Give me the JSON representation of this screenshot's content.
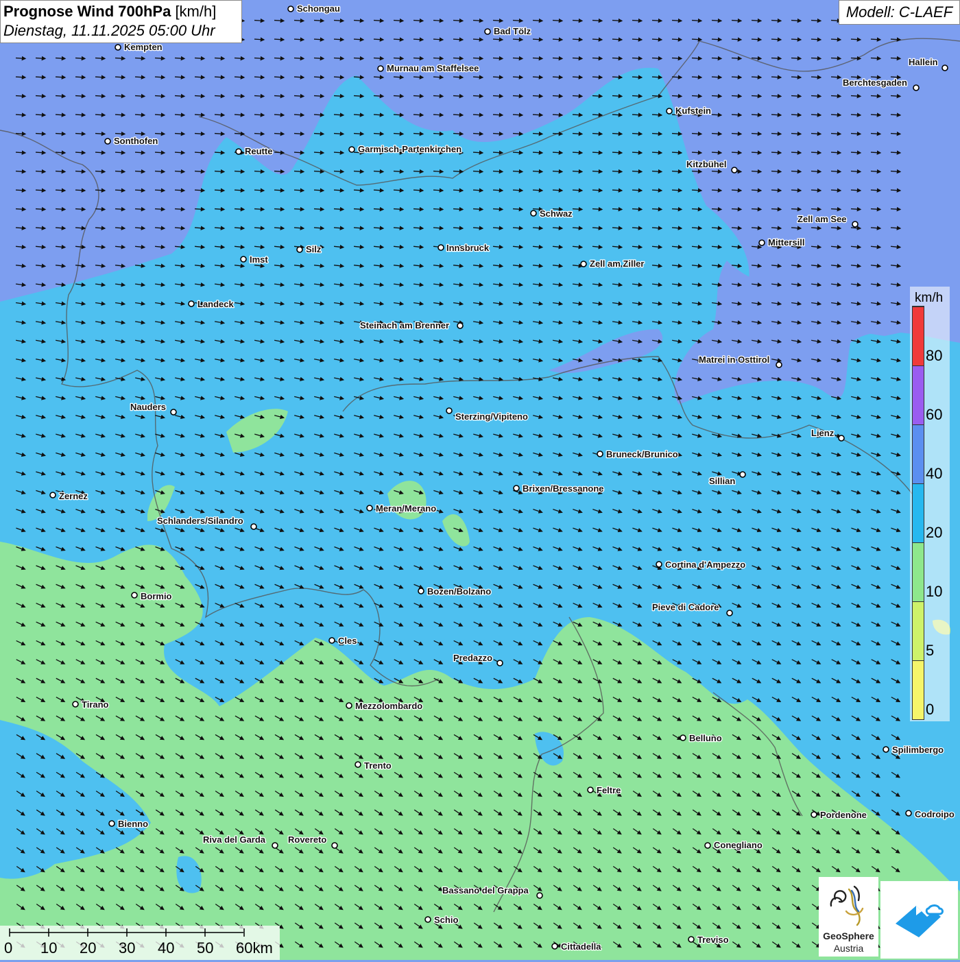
{
  "title": {
    "bold": "Prognose Wind 700hPa",
    "unit": "[km/h]",
    "datetime": "Dienstag, 11.11.2025 05:00 Uhr"
  },
  "model": "Modell: C-LAEF",
  "legend": {
    "unit": "km/h",
    "ticks": [
      "80",
      "60",
      "40",
      "20",
      "10",
      "5",
      "0"
    ],
    "colors": [
      "#f03a3a",
      "#9a5df0",
      "#5b8ff0",
      "#27b8ef",
      "#8ee78c",
      "#cef26a",
      "#f5f56a"
    ]
  },
  "colors": {
    "band_40_60": "#7d9ef0",
    "band_20_40": "#4ec0f0",
    "band_10_20": "#8fe49c",
    "band_5_10": "#cde97f",
    "band_light_blue": "#68c8f2"
  },
  "cities": [
    {
      "name": "Schongau",
      "dot": [
        424,
        13
      ],
      "label": [
        433,
        17
      ]
    },
    {
      "name": "Bad Tölz",
      "dot": [
        711,
        46
      ],
      "label": [
        720,
        50
      ]
    },
    {
      "name": "Kempten",
      "dot": [
        172,
        69
      ],
      "label": [
        181,
        73
      ]
    },
    {
      "name": "Murnau am Staffelsee",
      "dot": [
        555,
        100
      ],
      "label": [
        564,
        104
      ]
    },
    {
      "name": "Hallein",
      "dot": [
        1378,
        99
      ],
      "label": [
        1325,
        95
      ]
    },
    {
      "name": "Berchtesgaden",
      "dot": [
        1336,
        128
      ],
      "label": [
        1229,
        125
      ]
    },
    {
      "name": "Kufstein",
      "dot": [
        976,
        162
      ],
      "label": [
        985,
        166
      ]
    },
    {
      "name": "Sonthofen",
      "dot": [
        157,
        206
      ],
      "label": [
        166,
        210
      ]
    },
    {
      "name": "Garmisch-Partenkirchen",
      "dot": [
        513,
        218
      ],
      "label": [
        522,
        222
      ]
    },
    {
      "name": "Reutte",
      "dot": [
        348,
        221
      ],
      "label": [
        357,
        225
      ]
    },
    {
      "name": "Kitzbühel",
      "dot": [
        1071,
        248
      ],
      "label": [
        1001,
        244
      ]
    },
    {
      "name": "Schwaz",
      "dot": [
        778,
        311
      ],
      "label": [
        787,
        316
      ]
    },
    {
      "name": "Zell am See",
      "dot": [
        1247,
        327
      ],
      "label": [
        1163,
        324
      ]
    },
    {
      "name": "Mittersill",
      "dot": [
        1111,
        354
      ],
      "label": [
        1120,
        358
      ]
    },
    {
      "name": "Innsbruck",
      "dot": [
        643,
        361
      ],
      "label": [
        651,
        366
      ]
    },
    {
      "name": "Silz",
      "dot": [
        437,
        364
      ],
      "label": [
        446,
        368
      ]
    },
    {
      "name": "Imst",
      "dot": [
        355,
        378
      ],
      "label": [
        364,
        383
      ]
    },
    {
      "name": "Zell am Ziller",
      "dot": [
        851,
        385
      ],
      "label": [
        860,
        389
      ]
    },
    {
      "name": "Landeck",
      "dot": [
        279,
        443
      ],
      "label": [
        288,
        448
      ]
    },
    {
      "name": "Steinach am Brenner",
      "dot": [
        671,
        475
      ],
      "label": [
        525,
        479
      ]
    },
    {
      "name": "Matrei in Osttirol",
      "dot": [
        1136,
        532
      ],
      "label": [
        1019,
        529
      ]
    },
    {
      "name": "Nauders",
      "dot": [
        253,
        601
      ],
      "label": [
        190,
        598
      ]
    },
    {
      "name": "Sterzing/Vipiteno",
      "dot": [
        655,
        599
      ],
      "label": [
        664,
        612
      ]
    },
    {
      "name": "Lienz",
      "dot": [
        1227,
        639
      ],
      "label": [
        1183,
        636
      ]
    },
    {
      "name": "Bruneck/Brunico",
      "dot": [
        875,
        662
      ],
      "label": [
        884,
        667
      ]
    },
    {
      "name": "Sillian",
      "dot": [
        1083,
        692
      ],
      "label": [
        1034,
        706
      ]
    },
    {
      "name": "Brixen/Bressanone",
      "dot": [
        753,
        712
      ],
      "label": [
        762,
        717
      ]
    },
    {
      "name": "Zernez",
      "dot": [
        77,
        722
      ],
      "label": [
        86,
        728
      ]
    },
    {
      "name": "Meran/Merano",
      "dot": [
        539,
        741
      ],
      "label": [
        548,
        746
      ]
    },
    {
      "name": "Schlanders/Silandro",
      "dot": [
        370,
        768
      ],
      "label": [
        229,
        764
      ]
    },
    {
      "name": "Cortina d'Ampezzo",
      "dot": [
        961,
        823
      ],
      "label": [
        970,
        828
      ]
    },
    {
      "name": "Bozen/Bolzano",
      "dot": [
        614,
        862
      ],
      "label": [
        623,
        867
      ]
    },
    {
      "name": "Bormio",
      "dot": [
        196,
        868
      ],
      "label": [
        205,
        874
      ]
    },
    {
      "name": "Pieve di Cadore",
      "dot": [
        1064,
        894
      ],
      "label": [
        951,
        890
      ]
    },
    {
      "name": "Cles",
      "dot": [
        484,
        934
      ],
      "label": [
        493,
        939
      ]
    },
    {
      "name": "Predazzo",
      "dot": [
        729,
        967
      ],
      "label": [
        661,
        964
      ]
    },
    {
      "name": "Tirano",
      "dot": [
        110,
        1027
      ],
      "label": [
        119,
        1032
      ]
    },
    {
      "name": "Mezzolombardo",
      "dot": [
        509,
        1029
      ],
      "label": [
        518,
        1034
      ]
    },
    {
      "name": "Belluno",
      "dot": [
        996,
        1076
      ],
      "label": [
        1005,
        1081
      ]
    },
    {
      "name": "Spilimbergo",
      "dot": [
        1292,
        1093
      ],
      "label": [
        1301,
        1098
      ]
    },
    {
      "name": "Trento",
      "dot": [
        522,
        1115
      ],
      "label": [
        531,
        1121
      ]
    },
    {
      "name": "Feltre",
      "dot": [
        861,
        1152
      ],
      "label": [
        870,
        1157
      ]
    },
    {
      "name": "Pordenone",
      "dot": [
        1187,
        1188
      ],
      "label": [
        1196,
        1193
      ]
    },
    {
      "name": "Codroipo",
      "dot": [
        1325,
        1186
      ],
      "label": [
        1334,
        1192
      ]
    },
    {
      "name": "Bienno",
      "dot": [
        163,
        1201
      ],
      "label": [
        172,
        1206
      ]
    },
    {
      "name": "Riva del Garda",
      "dot": [
        401,
        1233
      ],
      "label": [
        296,
        1229
      ]
    },
    {
      "name": "Rovereto",
      "dot": [
        488,
        1233
      ],
      "label": [
        420,
        1229
      ]
    },
    {
      "name": "Conegliano",
      "dot": [
        1032,
        1233
      ],
      "label": [
        1041,
        1237
      ]
    },
    {
      "name": "Bassano del Grappa",
      "dot": [
        787,
        1306
      ],
      "label": [
        645,
        1303
      ]
    },
    {
      "name": "Schio",
      "dot": [
        624,
        1341
      ],
      "label": [
        633,
        1346
      ]
    },
    {
      "name": "Treviso",
      "dot": [
        1008,
        1370
      ],
      "label": [
        1017,
        1375
      ]
    },
    {
      "name": "Cittadella",
      "dot": [
        809,
        1380
      ],
      "label": [
        818,
        1385
      ]
    }
  ],
  "scale_bar": {
    "labels": [
      "0",
      "10",
      "20",
      "30",
      "40",
      "50",
      "60km"
    ]
  },
  "logos": {
    "geosphere_line1": "GeoSphere",
    "geosphere_line2": "Austria"
  }
}
